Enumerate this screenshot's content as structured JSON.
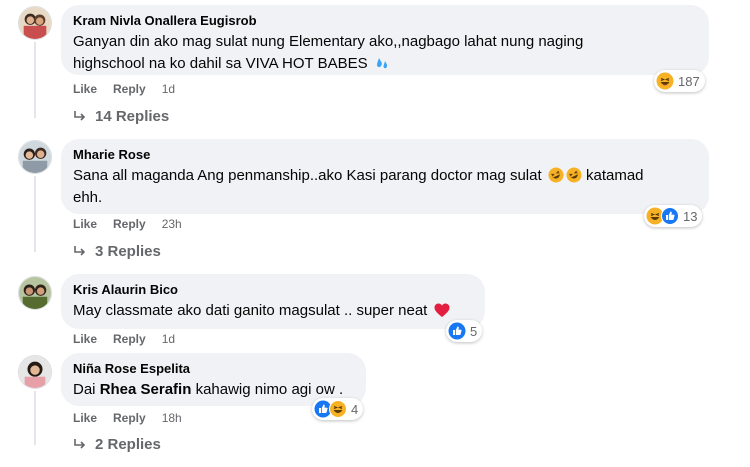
{
  "comments": [
    {
      "author": "Kram Nivla Onallera Eugisrob",
      "text_line1": "Ganyan din ako mag sulat nung Elementary ako,,nagbago lahat nung naging",
      "text_line2": "highschool na ko dahil sa VIVA HOT BABES",
      "trailing_emoji": "sweat-droplets-icon",
      "reactions": [
        "haha-reaction-icon"
      ],
      "reaction_count": "187",
      "like_label": "Like",
      "reply_label": "Reply",
      "time": "1d",
      "replies_label": "14 Replies"
    },
    {
      "author": "Mharie Rose",
      "text_line1_pre": "Sana all maganda Ang penmanship..ako Kasi parang doctor mag sulat",
      "inline_emojis": [
        "rolling-laughing-icon",
        "rolling-laughing-icon"
      ],
      "text_line1_post": "katamad",
      "text_line2": "ehh.",
      "reactions": [
        "haha-reaction-icon",
        "like-reaction-icon"
      ],
      "reaction_count": "13",
      "like_label": "Like",
      "reply_label": "Reply",
      "time": "23h",
      "replies_label": "3 Replies"
    },
    {
      "author": "Kris Alaurin Bico",
      "text": "May classmate ako dati ganito magsulat .. super neat",
      "trailing_emoji": "red-heart-icon",
      "reactions": [
        "like-reaction-icon"
      ],
      "reaction_count": "5",
      "like_label": "Like",
      "reply_label": "Reply",
      "time": "1d"
    },
    {
      "author": "Niña Rose Espelita",
      "text_pre": "Dai",
      "mention": "Rhea Serafin",
      "text_post": "kahawig nimo agi ow .",
      "reactions": [
        "like-reaction-icon",
        "haha-reaction-icon"
      ],
      "reaction_count": "4",
      "like_label": "Like",
      "reply_label": "Reply",
      "time": "18h",
      "replies_label": "2 Replies"
    }
  ],
  "colors": {
    "bubble": "#f0f2f5",
    "secondary_text": "#65676b",
    "like_blue": "#1877f2",
    "haha_yellow": "#f7b125"
  }
}
